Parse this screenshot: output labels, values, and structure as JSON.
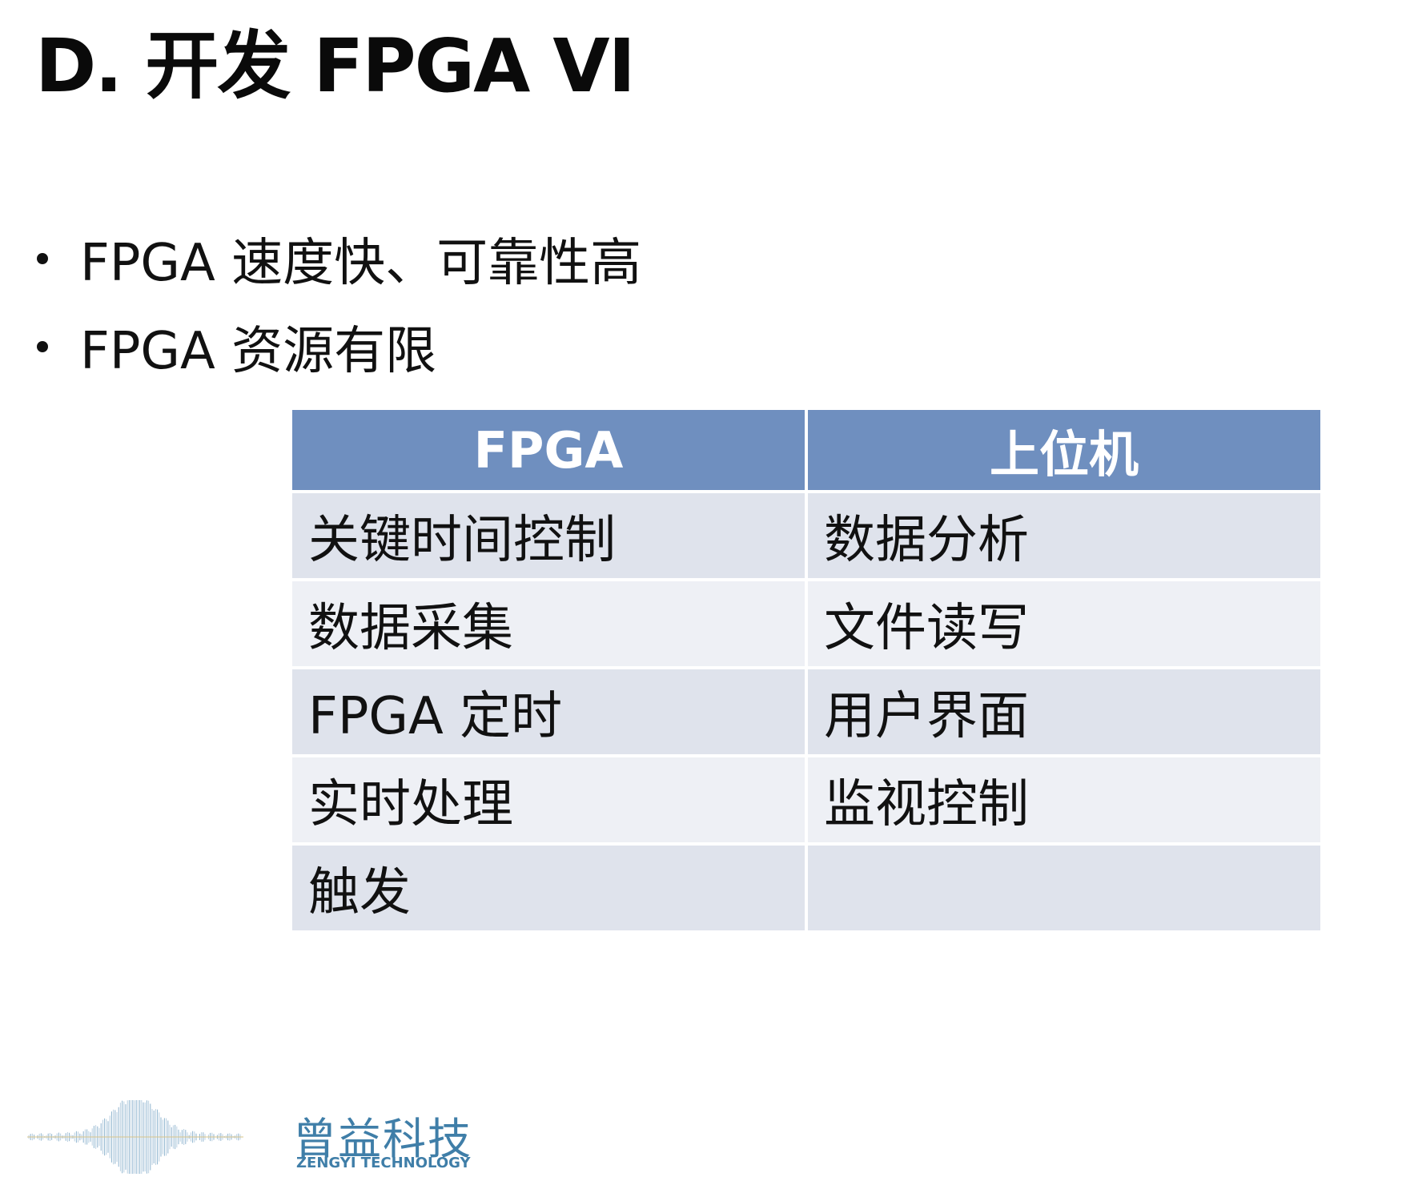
{
  "slide": {
    "title": "D. 开发 FPGA VI",
    "bullets": [
      "FPGA 速度快、可靠性高",
      "FPGA 资源有限"
    ],
    "table": {
      "headers": [
        "FPGA",
        "上位机"
      ],
      "rows": [
        [
          "关键时间控制",
          "数据分析"
        ],
        [
          "数据采集",
          "文件读写"
        ],
        [
          "FPGA 定时",
          "用户界面"
        ],
        [
          "实时处理",
          "监视控制"
        ],
        [
          "触发",
          ""
        ]
      ],
      "colors": {
        "header_bg": "#6f8fbf",
        "row_dark": "#dfe3ec",
        "row_light": "#eef0f5"
      }
    },
    "logo": {
      "name_cn": "曾益科技",
      "name_en": "ZENGYI TECHNOLOGY",
      "color": "#3f7ea8",
      "icon": "waveform-icon"
    }
  }
}
